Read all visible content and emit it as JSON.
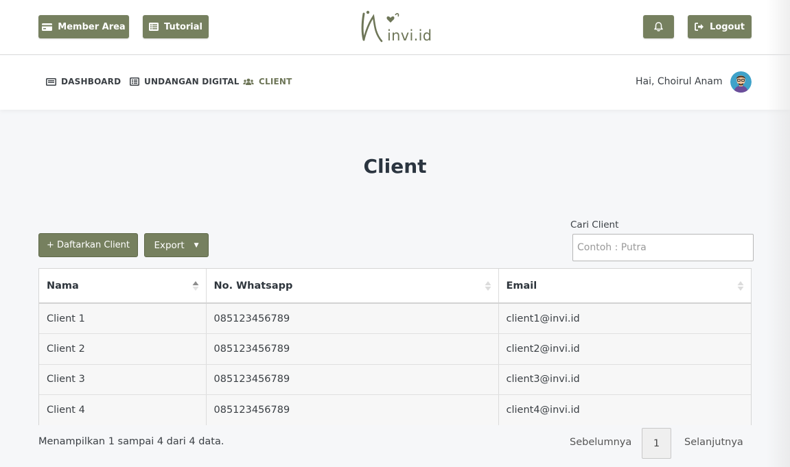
{
  "header": {
    "member_area_label": "Member Area",
    "tutorial_label": "Tutorial",
    "logout_label": "Logout",
    "logo_text": "invi.id",
    "brand_color": "#76805f"
  },
  "nav": {
    "items": [
      {
        "label": "DASHBOARD",
        "icon": "dashboard-icon"
      },
      {
        "label": "UNDANGAN DIGITAL",
        "icon": "list-icon"
      },
      {
        "label": "CLIENT",
        "icon": "users-icon"
      }
    ],
    "greeting": "Hai, Choirul Anam"
  },
  "main": {
    "title": "Client",
    "add_button_label": "+ Daftarkan Client",
    "export_label": "Export",
    "search": {
      "label": "Cari Client",
      "placeholder": "Contoh : Putra",
      "value": ""
    }
  },
  "table": {
    "columns": [
      "Nama",
      "No. Whatsapp",
      "Email"
    ],
    "rows": [
      [
        "Client 1",
        "085123456789",
        "client1@invi.id"
      ],
      [
        "Client 2",
        "085123456789",
        "client2@invi.id"
      ],
      [
        "Client 3",
        "085123456789",
        "client3@invi.id"
      ],
      [
        "Client 4",
        "085123456789",
        "client4@invi.id"
      ]
    ]
  },
  "pagination": {
    "info": "Menampilkan 1 sampai 4 dari 4 data.",
    "prev_label": "Sebelumnya",
    "current_page": "1",
    "next_label": "Selanjutnya"
  }
}
